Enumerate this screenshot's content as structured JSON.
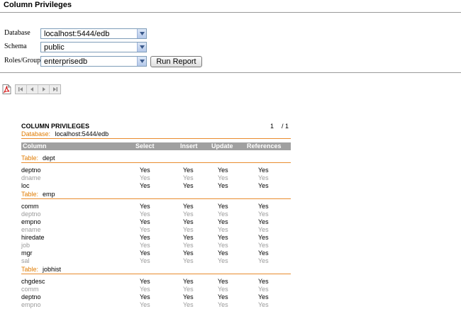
{
  "page": {
    "title": "Column Privileges"
  },
  "form": {
    "database": {
      "label": "Database",
      "value": "localhost:5444/edb"
    },
    "schema": {
      "label": "Schema",
      "value": "public"
    },
    "roles": {
      "label": "Roles/Groups",
      "value": "enterprisedb"
    },
    "run_label": "Run Report"
  },
  "report": {
    "title": "COLUMN PRIVILEGES",
    "database_label": "Database:",
    "database_value": "localhost:5444/edb",
    "page_current": "1",
    "page_total": "/ 1",
    "columns": [
      "Column",
      "Select",
      "Insert",
      "Update",
      "References"
    ],
    "table_label": "Table:",
    "tables": [
      {
        "name": "dept",
        "rows": [
          {
            "column": "deptno",
            "select": "Yes",
            "insert": "Yes",
            "update": "Yes",
            "references": "Yes"
          },
          {
            "column": "dname",
            "select": "Yes",
            "insert": "Yes",
            "update": "Yes",
            "references": "Yes"
          },
          {
            "column": "loc",
            "select": "Yes",
            "insert": "Yes",
            "update": "Yes",
            "references": "Yes"
          }
        ]
      },
      {
        "name": "emp",
        "rows": [
          {
            "column": "comm",
            "select": "Yes",
            "insert": "Yes",
            "update": "Yes",
            "references": "Yes"
          },
          {
            "column": "deptno",
            "select": "Yes",
            "insert": "Yes",
            "update": "Yes",
            "references": "Yes"
          },
          {
            "column": "empno",
            "select": "Yes",
            "insert": "Yes",
            "update": "Yes",
            "references": "Yes"
          },
          {
            "column": "ename",
            "select": "Yes",
            "insert": "Yes",
            "update": "Yes",
            "references": "Yes"
          },
          {
            "column": "hiredate",
            "select": "Yes",
            "insert": "Yes",
            "update": "Yes",
            "references": "Yes"
          },
          {
            "column": "job",
            "select": "Yes",
            "insert": "Yes",
            "update": "Yes",
            "references": "Yes"
          },
          {
            "column": "mgr",
            "select": "Yes",
            "insert": "Yes",
            "update": "Yes",
            "references": "Yes"
          },
          {
            "column": "sal",
            "select": "Yes",
            "insert": "Yes",
            "update": "Yes",
            "references": "Yes"
          }
        ]
      },
      {
        "name": "jobhist",
        "rows": [
          {
            "column": "chgdesc",
            "select": "Yes",
            "insert": "Yes",
            "update": "Yes",
            "references": "Yes"
          },
          {
            "column": "comm",
            "select": "Yes",
            "insert": "Yes",
            "update": "Yes",
            "references": "Yes"
          },
          {
            "column": "deptno",
            "select": "Yes",
            "insert": "Yes",
            "update": "Yes",
            "references": "Yes"
          },
          {
            "column": "empno",
            "select": "Yes",
            "insert": "Yes",
            "update": "Yes",
            "references": "Yes"
          }
        ]
      }
    ]
  },
  "icons": {
    "pdf": "pdf-icon",
    "first": "first-page-icon",
    "prev": "prev-page-icon",
    "next": "next-page-icon",
    "last": "last-page-icon"
  },
  "colors": {
    "accent": "#e07b00",
    "header_bg": "#a0a0a0",
    "dim_text": "#9a9a9a"
  }
}
